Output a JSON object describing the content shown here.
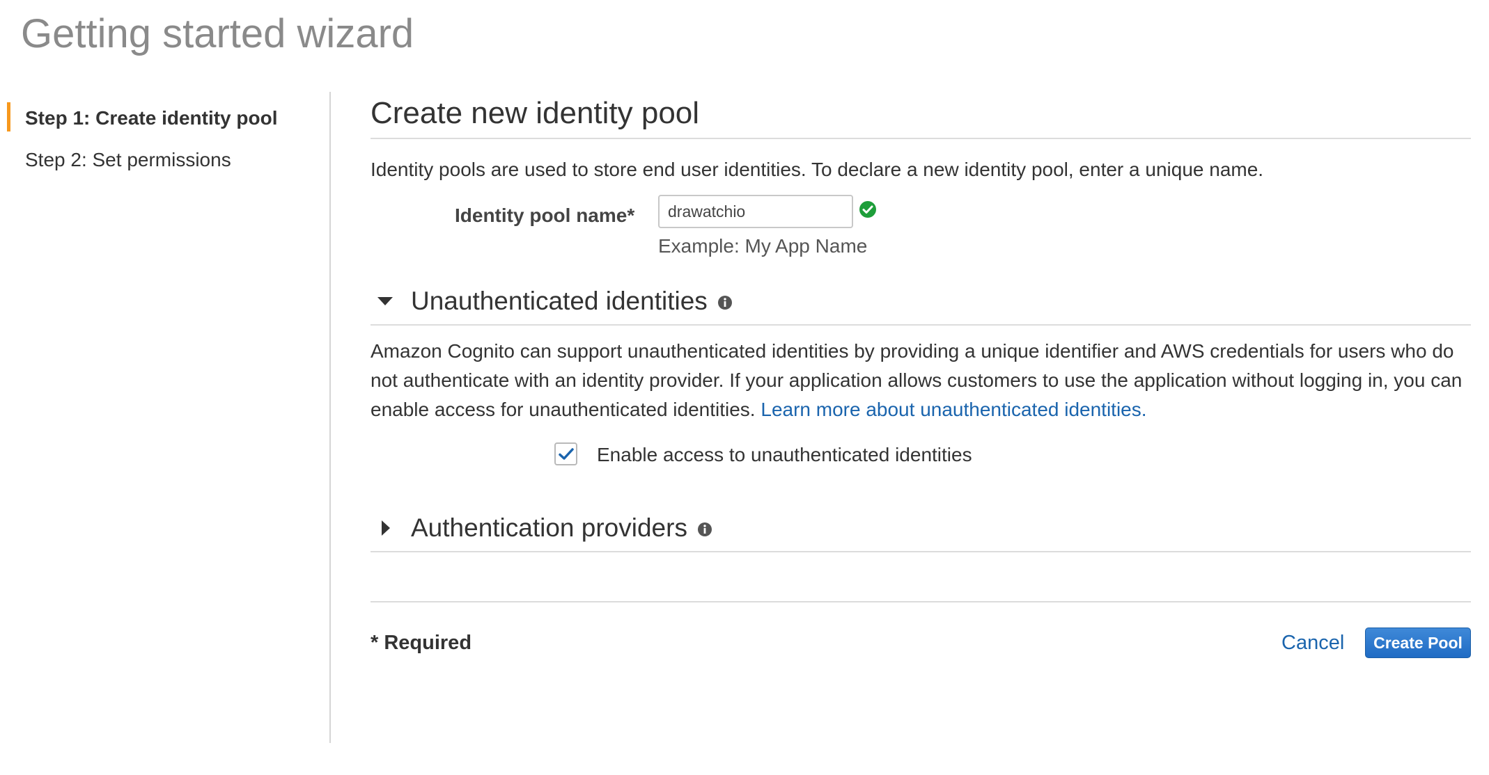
{
  "page": {
    "title": "Getting started wizard"
  },
  "sidebar": {
    "steps": [
      {
        "label": "Step 1: Create identity pool",
        "active": true
      },
      {
        "label": "Step 2: Set permissions",
        "active": false
      }
    ]
  },
  "main": {
    "title": "Create new identity pool",
    "intro": "Identity pools are used to store end user identities. To declare a new identity pool, enter a unique name.",
    "pool_name": {
      "label": "Identity pool name*",
      "value": "drawatchio",
      "hint": "Example: My App Name",
      "valid": true
    },
    "unauth_section": {
      "title": "Unauthenticated identities",
      "expanded": true,
      "description": "Amazon Cognito can support unauthenticated identities by providing a unique identifier and AWS credentials for users who do not authenticate with an identity provider. If your application allows customers to use the application without logging in, you can enable access for unauthenticated identities.",
      "learn_more": "Learn more about unauthenticated identities.",
      "checkbox_label": "Enable access to unauthenticated identities",
      "checked": true
    },
    "auth_section": {
      "title": "Authentication providers",
      "expanded": false
    },
    "footer": {
      "required": "* Required",
      "cancel": "Cancel",
      "create": "Create Pool"
    }
  },
  "colors": {
    "accent": "#f7981d",
    "link": "#1a64ad",
    "primary_button": "#1f6bc4",
    "success": "#1e9e3a",
    "checkmark": "#1a64ad"
  },
  "icons": {
    "valid": "check-circle-icon",
    "info": "info-icon",
    "expanded": "caret-down-icon",
    "collapsed": "caret-right-icon",
    "checkbox": "checkmark-icon"
  }
}
